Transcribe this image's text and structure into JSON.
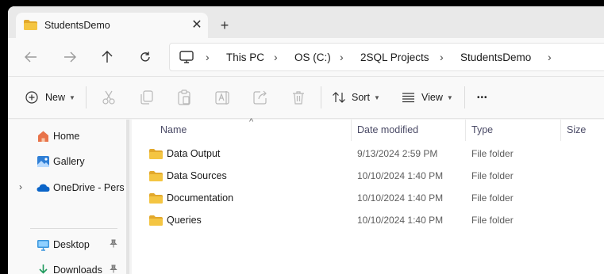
{
  "tab": {
    "title": "StudentsDemo",
    "close_glyph": "✕",
    "new_tab_glyph": "+"
  },
  "address_bar": {
    "breadcrumbs": [
      "This PC",
      "OS (C:)",
      "2SQL Projects",
      "StudentsDemo"
    ],
    "separator": "›"
  },
  "command_bar": {
    "new_label": "New",
    "sort_label": "Sort",
    "view_label": "View",
    "more_label": "•••"
  },
  "nav_pane": {
    "items": [
      {
        "label": "Home",
        "icon": "home-icon"
      },
      {
        "label": "Gallery",
        "icon": "gallery-icon"
      },
      {
        "label": "OneDrive - Pers",
        "icon": "onedrive-cloud-icon"
      },
      {
        "label": "Desktop",
        "icon": "desktop-icon"
      },
      {
        "label": "Downloads",
        "icon": "downloads-icon"
      }
    ],
    "expand_glyph": "›",
    "pin_glyph": "📌"
  },
  "file_list": {
    "columns": [
      "Name",
      "Date modified",
      "Type",
      "Size"
    ],
    "sort_glyph": "^",
    "rows": [
      {
        "name": "Data Output",
        "date": "9/13/2024 2:59 PM",
        "type": "File folder"
      },
      {
        "name": "Data Sources",
        "date": "10/10/2024 1:40 PM",
        "type": "File folder"
      },
      {
        "name": "Documentation",
        "date": "10/10/2024 1:40 PM",
        "type": "File folder"
      },
      {
        "name": "Queries",
        "date": "10/10/2024 1:40 PM",
        "type": "File folder"
      }
    ]
  },
  "colors": {
    "folder": "#f4c542",
    "folder_dark": "#e2a82b",
    "onedrive": "#0a64c8",
    "accent": "#0067c0"
  }
}
